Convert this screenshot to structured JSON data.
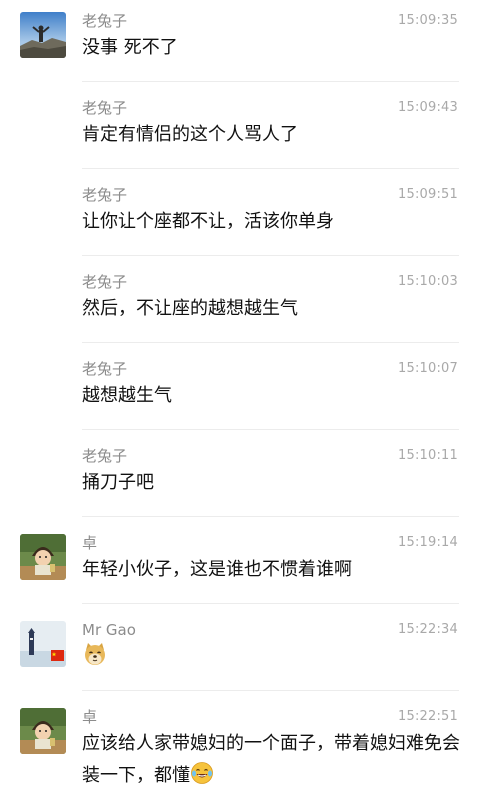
{
  "messages": [
    {
      "sender": "老兔子",
      "time": "15:09:35",
      "text": "没事 死不了",
      "avatar": "mountain-photo"
    },
    {
      "sender": "老兔子",
      "time": "15:09:43",
      "text": "肯定有情侣的这个人骂人了"
    },
    {
      "sender": "老兔子",
      "time": "15:09:51",
      "text": "让你让个座都不让，活该你单身"
    },
    {
      "sender": "老兔子",
      "time": "15:10:03",
      "text": "然后，不让座的越想越生气"
    },
    {
      "sender": "老兔子",
      "time": "15:10:07",
      "text": "越想越生气"
    },
    {
      "sender": "老兔子",
      "time": "15:10:11",
      "text": "捅刀子吧"
    },
    {
      "sender": "卓",
      "time": "15:19:14",
      "text": "年轻小伙子，这是谁也不惯着谁啊",
      "avatar": "cartoon-boy"
    },
    {
      "sender": "Mr Gao",
      "time": "15:22:34",
      "text": "",
      "emoji": "doge-emoji",
      "avatar": "lighthouse-flag"
    },
    {
      "sender": "卓",
      "time": "15:22:51",
      "text": "应该给人家带媳妇的一个面子，带着媳妇难免会装一下，都懂",
      "emoji": "tears-of-joy-emoji",
      "avatar": "cartoon-boy"
    }
  ]
}
